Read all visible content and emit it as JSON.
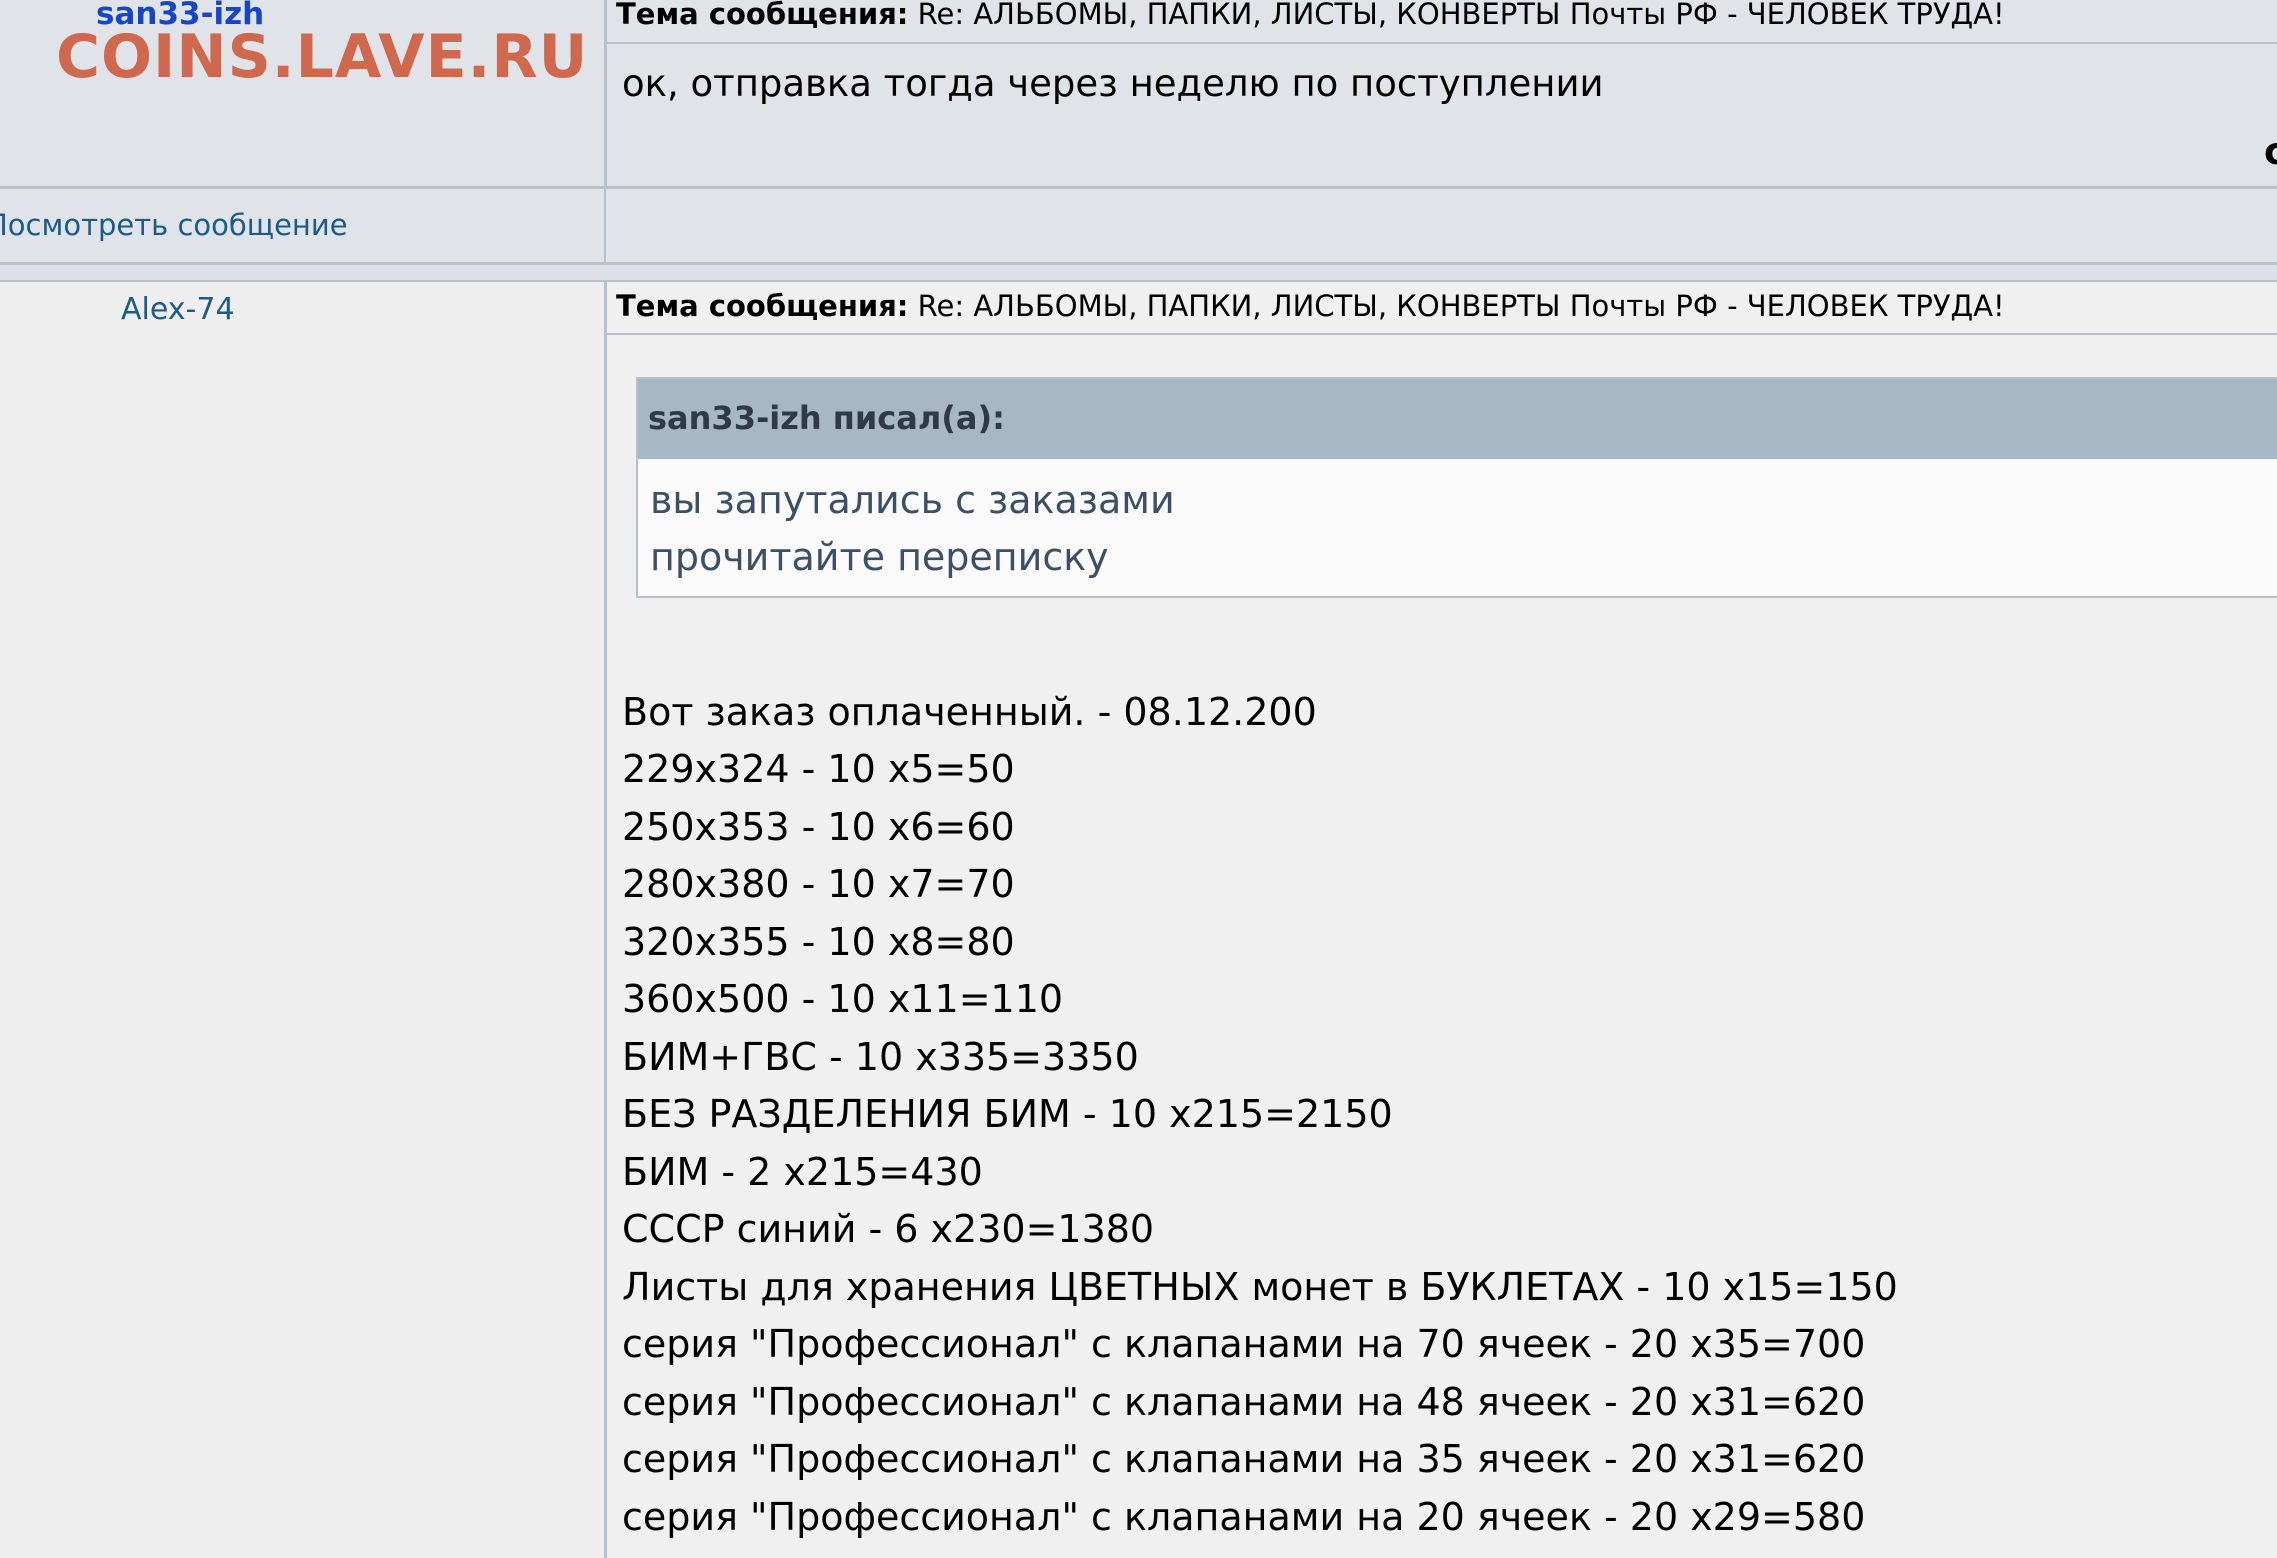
{
  "post1": {
    "author": "san33-izh",
    "watermark": "COINS.LAVE.RU",
    "subject_label": "Тема сообщения:",
    "subject_text": " Re: АЛЬБОМЫ, ПАПКИ, ЛИСТЫ, КОНВЕРТЫ Почты РФ - ЧЕЛОВЕК ТРУДА!",
    "body": "ок, отправка тогда через неделю по поступлении",
    "edge_glyph": "c",
    "view_link": "Посмотреть сообщение"
  },
  "post2": {
    "author": "Alex-74",
    "subject_label": "Тема сообщения:",
    "subject_text": " Re: АЛЬБОМЫ, ПАПКИ, ЛИСТЫ, КОНВЕРТЫ Почты РФ - ЧЕЛОВЕК ТРУДА!",
    "quote": {
      "author": "san33-izh писал(а):",
      "lines": [
        "вы запутались с заказами",
        "прочитайте переписку"
      ]
    },
    "lines": [
      "Вот заказ оплаченный. - 08.12.200",
      "229x324 - 10 x5=50",
      "250x353 - 10 x6=60",
      "280x380 - 10 x7=70",
      "320x355 - 10 x8=80",
      "360x500 - 10 x11=110",
      "БИМ+ГВС - 10 x335=3350",
      "БЕЗ РАЗДЕЛЕНИЯ БИМ - 10 x215=2150",
      "БИМ - 2 x215=430",
      "СССР синий - 6 x230=1380",
      "Листы для хранения ЦВЕТНЫХ монет в БУКЛЕТАХ - 10 x15=150",
      "серия \"Профессионал\" с клапанами на 70 ячеек - 20 x35=700",
      "серия \"Профессионал\" с клапанами на 48 ячеек - 20 x31=620",
      "серия \"Профессионал\" с клапанами на 35 ячеек - 20 x31=620",
      "серия \"Профессионал\" с клапанами на 20 ячеек - 20 x29=580"
    ]
  }
}
